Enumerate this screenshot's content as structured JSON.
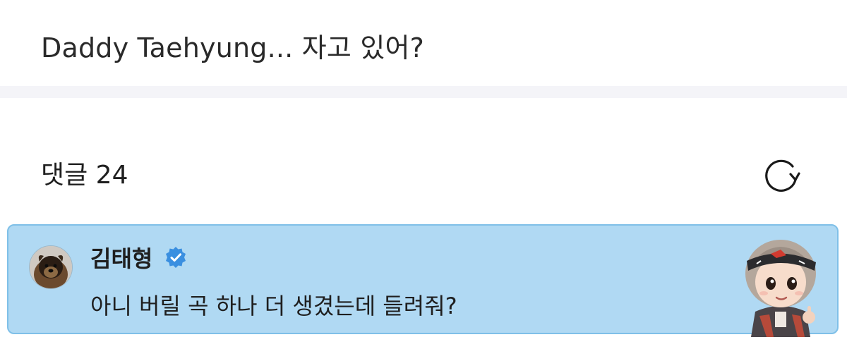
{
  "post": {
    "text": "Daddy Taehyung... 자고 있어?"
  },
  "comments": {
    "title": "댓글 24",
    "refresh_icon": "refresh-icon"
  },
  "highlighted_comment": {
    "author": "김태형",
    "verified_icon": "verified-badge-icon",
    "text": "아니 버릴 곡 하나 더 생겼는데 들려줘?",
    "avatar_icon": "dog-avatar",
    "sticker_icon": "character-sticker"
  },
  "colors": {
    "card_bg": "#b0d9f3",
    "card_border": "#7fc0e8",
    "verified": "#3a8fe0",
    "divider": "#f4f4f8"
  }
}
